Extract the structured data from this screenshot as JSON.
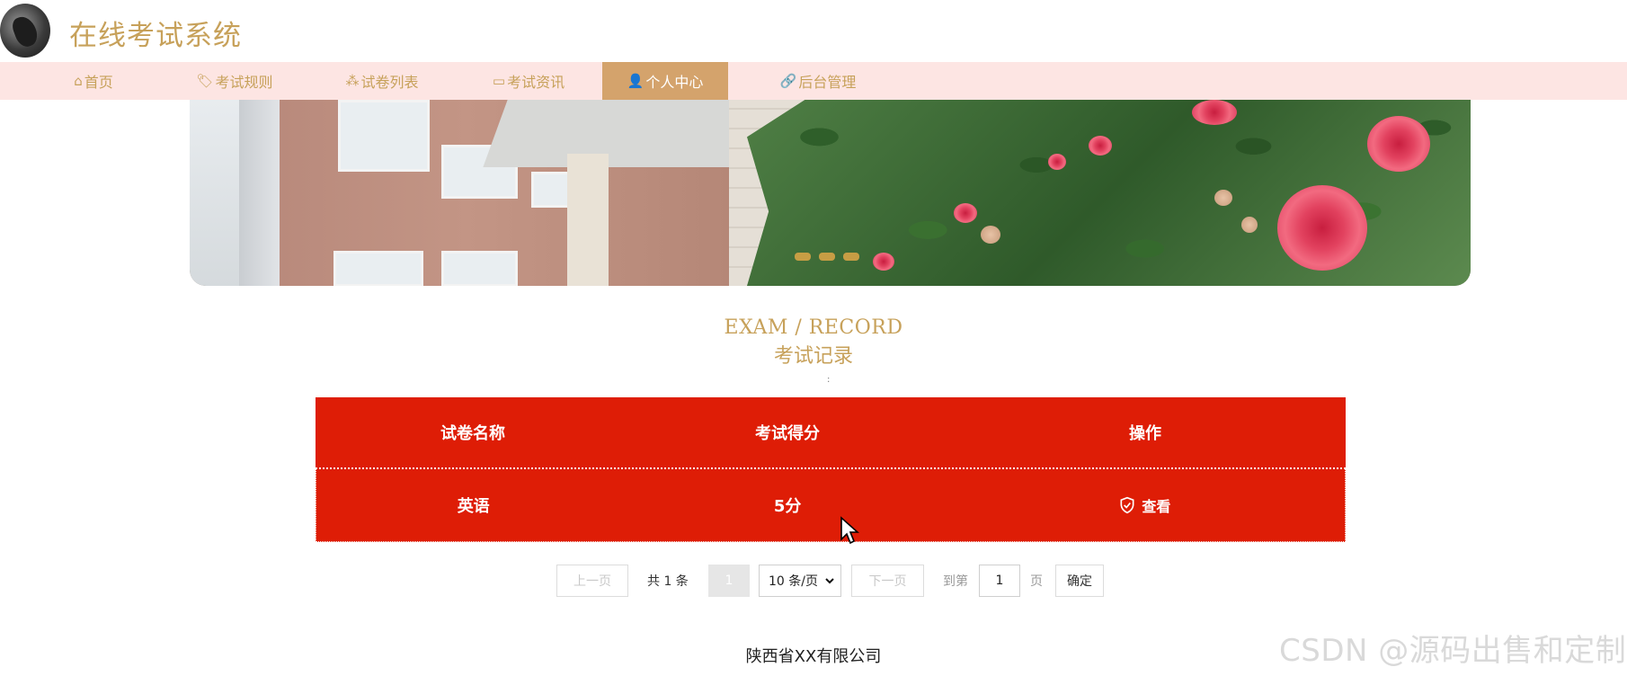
{
  "header": {
    "site_title": "在线考试系统",
    "logo_icon": "avatar-logo"
  },
  "nav": {
    "items": [
      {
        "icon": "⌂",
        "icon_name": "home-icon",
        "label": "首页",
        "active": false
      },
      {
        "icon": "🏷",
        "icon_name": "tag-icon",
        "label": "考试规则",
        "active": false
      },
      {
        "icon": "⁂",
        "icon_name": "spark-icon",
        "label": "试卷列表",
        "active": false
      },
      {
        "icon": "▭",
        "icon_name": "note-icon",
        "label": "考试资讯",
        "active": false
      },
      {
        "icon": "👤",
        "icon_name": "user-icon",
        "label": "个人中心",
        "active": true
      },
      {
        "icon": "🔗",
        "icon_name": "link-icon",
        "label": "后台管理",
        "active": false
      }
    ],
    "background_color": "#fde5e3",
    "active_color": "#d4a36c",
    "text_color": "#c7a15a"
  },
  "banner": {
    "slides": 3
  },
  "section": {
    "title_en": "EXAM / RECORD",
    "title_cn": "考试记录",
    "mark": ":"
  },
  "table": {
    "columns": [
      "试卷名称",
      "考试得分",
      "操作"
    ],
    "rows": [
      {
        "name": "英语",
        "score": "5分",
        "action": "查看"
      }
    ],
    "background_color": "#de1d06"
  },
  "pagination": {
    "prev": "上一页",
    "total": "共 1 条",
    "current_page": "1",
    "page_size": "10 条/页",
    "next": "下一页",
    "goto_label": "到第",
    "goto_value": "1",
    "page_unit": "页",
    "confirm": "确定"
  },
  "footer": {
    "company": "陕西省XX有限公司"
  },
  "watermark": "CSDN @源码出售和定制"
}
